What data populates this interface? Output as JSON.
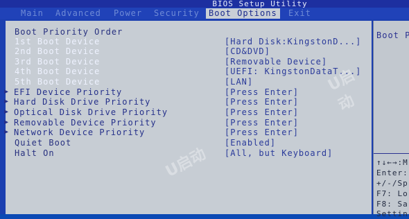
{
  "title": "BIOS Setup Utility",
  "menu": {
    "main": "Main",
    "advanced": "Advanced",
    "power": "Power",
    "security": "Security",
    "boot_options": "Boot Options",
    "exit": "Exit"
  },
  "boot": {
    "heading": "Boot Priority Order",
    "devices": [
      {
        "label": "1st Boot Device",
        "value": "[Hard Disk:KingstonD...]"
      },
      {
        "label": "2nd Boot Device",
        "value": "[CD&DVD]"
      },
      {
        "label": "3rd Boot Device",
        "value": "[Removable Device]"
      },
      {
        "label": "4th Boot Device",
        "value": "[UEFI: KingstonDataT...]"
      },
      {
        "label": "5th Boot Device",
        "value": "[LAN]"
      }
    ],
    "submenus": [
      {
        "label": "EFI Device Priority",
        "value": "[Press Enter]"
      },
      {
        "label": "Hard Disk Drive Priority",
        "value": "[Press Enter]"
      },
      {
        "label": "Optical Disk Drive Priority",
        "value": "[Press Enter]"
      },
      {
        "label": "Removable Device Priority",
        "value": "[Press Enter]"
      },
      {
        "label": "Network Device Priority",
        "value": "[Press Enter]"
      }
    ],
    "quiet_boot": {
      "label": "Quiet Boot",
      "value": "[Enabled]"
    },
    "halt_on": {
      "label": "Halt On",
      "value": "[All, but Keyboard]"
    }
  },
  "help": {
    "top": "Boot P",
    "keys": [
      "↑↓←→:M",
      "Enter:",
      "+/-/Sp",
      "F7: Lo",
      "F8: Sa",
      "Settin"
    ]
  },
  "watermark": "U启动"
}
